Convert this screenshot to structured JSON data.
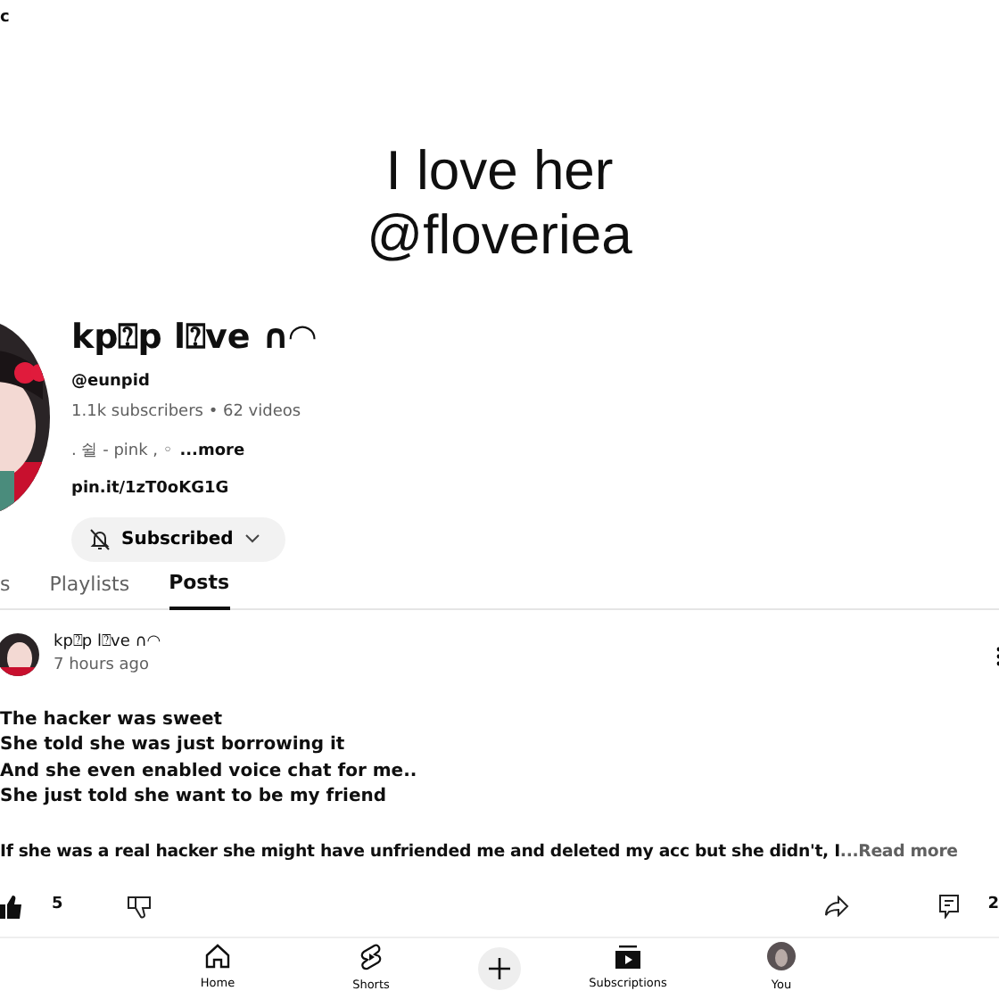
{
  "top_bar": {
    "title": "c"
  },
  "banner": {
    "lines": [
      "I love her",
      "@floveriea"
    ]
  },
  "channel": {
    "name": "kp⍰p l⍰ve ∩◠",
    "handle": "@eunpid",
    "stats": "1.1k subscribers • 62 videos",
    "description": ". 쉴 - pink , ◦",
    "more": "...more",
    "link": "pin.it/1zT0oKG1G",
    "subscribe_button": "Subscribed"
  },
  "tabs": [
    {
      "label": "s",
      "selected": false
    },
    {
      "label": "Playlists",
      "selected": false
    },
    {
      "label": "Posts",
      "selected": true
    }
  ],
  "post": {
    "author": "kp⍰p l⍰ve ∩◠",
    "time": "7 hours ago",
    "lines": [
      "The hacker was sweet",
      "She told she was just borrowing it",
      "And she even enabled voice chat for me..",
      "She just told she want to be my friend"
    ],
    "paragraph": "If she was a real hacker she might have unfriended me and deleted my acc but she didn't, I",
    "read_more": "...Read more",
    "likes": "5",
    "comments": "2"
  },
  "bottom_nav": [
    {
      "label": "Home",
      "kind": "home"
    },
    {
      "label": "Shorts",
      "kind": "shorts"
    },
    {
      "kind": "create"
    },
    {
      "label": "Subscriptions",
      "kind": "subscriptions"
    },
    {
      "label": "You",
      "kind": "avatar"
    }
  ]
}
